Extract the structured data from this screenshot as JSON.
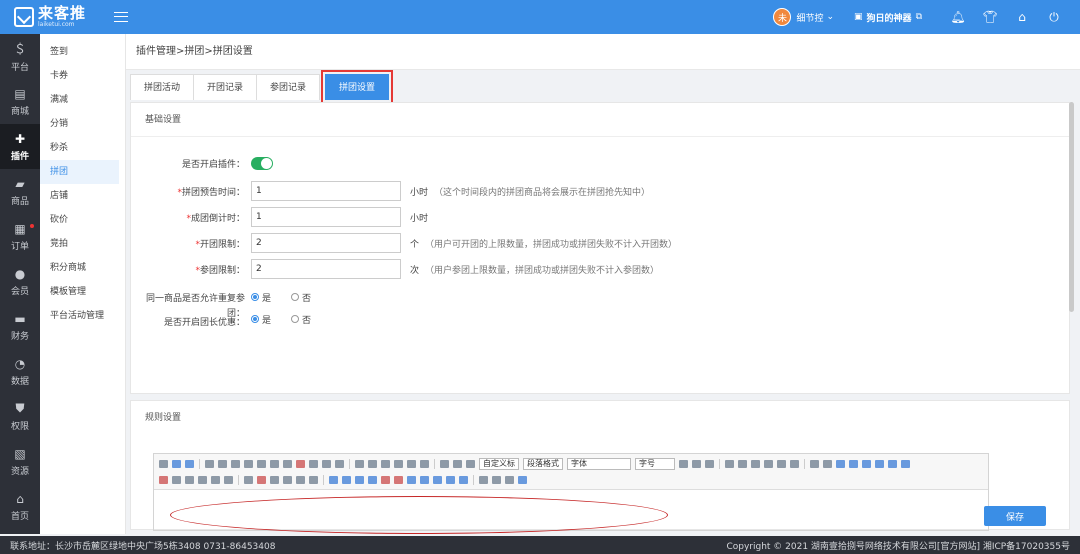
{
  "brand": {
    "name_cn": "来客推",
    "name_en": "laiketui.com"
  },
  "topbar": {
    "user_avatar": "未",
    "user_name": "细节控",
    "shop_label": "狗日的神器",
    "icons": [
      "bell-icon",
      "shirt-icon",
      "home-icon",
      "power-icon"
    ]
  },
  "rail": [
    {
      "label": "平台",
      "icon": "dollar-icon"
    },
    {
      "label": "商城",
      "icon": "shop-icon"
    },
    {
      "label": "插件",
      "icon": "puzzle-icon"
    },
    {
      "label": "商品",
      "icon": "bag-icon"
    },
    {
      "label": "订单",
      "icon": "order-icon"
    },
    {
      "label": "会员",
      "icon": "user-icon"
    },
    {
      "label": "财务",
      "icon": "wallet-icon"
    },
    {
      "label": "数据",
      "icon": "pie-icon"
    },
    {
      "label": "权限",
      "icon": "shield-icon"
    },
    {
      "label": "资源",
      "icon": "image-icon"
    },
    {
      "label": "首页",
      "icon": "home-icon"
    }
  ],
  "submenu": [
    "签到",
    "卡券",
    "满减",
    "分销",
    "秒杀",
    "拼团",
    "店铺",
    "砍价",
    "竞拍",
    "积分商城",
    "模板管理",
    "平台活动管理"
  ],
  "breadcrumb": "插件管理>拼团>拼团设置",
  "tabs": [
    "拼团活动",
    "开团记录",
    "参团记录",
    "拼团设置"
  ],
  "basic": {
    "title": "基础设置",
    "enable_label": "是否开启插件：",
    "preview_label": "拼团预告时间：",
    "preview_value": "1",
    "preview_unit": "小时",
    "preview_hint": "（这个时间段内的拼团商品将会展示在拼团抢先知中）",
    "countdown_label": "成团倒计时：",
    "countdown_value": "1",
    "countdown_unit": "小时",
    "open_limit_label": "开团限制：",
    "open_limit_value": "2",
    "open_limit_unit": "个",
    "open_limit_hint": "（用户可开团的上限数量，拼团成功或拼团失败不计入开团数）",
    "join_limit_label": "参团限制：",
    "join_limit_value": "2",
    "join_limit_unit": "次",
    "join_limit_hint": "（用户参团上限数量，拼团成功或拼团失败不计入参团数）",
    "repeat_label": "同一商品是否允许重复参",
    "repeat_yes": "是",
    "repeat_no": "否",
    "leader_label_1": "团：",
    "leader_label_2": "是否开启团长优惠：",
    "leader_yes": "是",
    "leader_no": "否"
  },
  "rules": {
    "title": "规则设置",
    "font_def": "自定义标",
    "para_fmt": "段落格式",
    "font_family": "字体",
    "font_size": "字号"
  },
  "save_label": "保存",
  "footer": {
    "address": "联系地址：长沙市岳麓区绿地中央广场5栋3408 0731-86453408",
    "copyright": "Copyright © 2021 湖南壹拾捌号网络技术有限公司[官方网站]  湘ICP备17020355号"
  }
}
